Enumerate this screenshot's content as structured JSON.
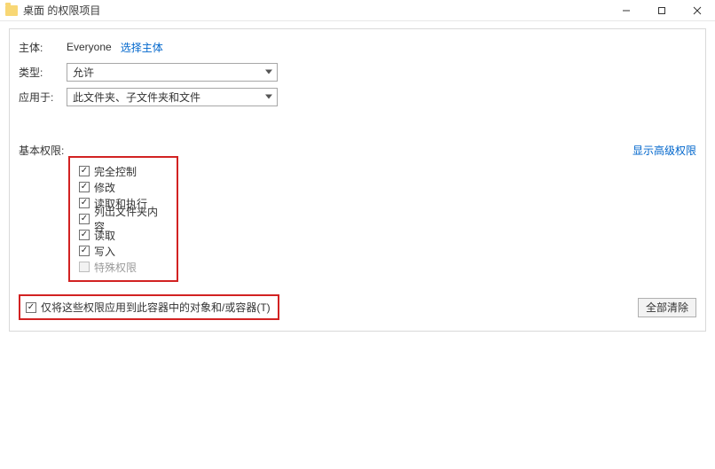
{
  "window": {
    "title": "桌面 的权限项目"
  },
  "principal": {
    "label": "主体:",
    "value": "Everyone",
    "select_link": "选择主体"
  },
  "type": {
    "label": "类型:",
    "value": "允许"
  },
  "applies_to": {
    "label": "应用于:",
    "value": "此文件夹、子文件夹和文件"
  },
  "permissions": {
    "title": "基本权限:",
    "show_advanced": "显示高级权限",
    "items": [
      {
        "label": "完全控制",
        "checked": true,
        "disabled": false
      },
      {
        "label": "修改",
        "checked": true,
        "disabled": false
      },
      {
        "label": "读取和执行",
        "checked": true,
        "disabled": false
      },
      {
        "label": "列出文件夹内容",
        "checked": true,
        "disabled": false
      },
      {
        "label": "读取",
        "checked": true,
        "disabled": false
      },
      {
        "label": "写入",
        "checked": true,
        "disabled": false
      },
      {
        "label": "特殊权限",
        "checked": false,
        "disabled": true
      }
    ]
  },
  "apply_only": {
    "label": "仅将这些权限应用到此容器中的对象和/或容器(T)",
    "checked": true
  },
  "buttons": {
    "clear_all": "全部清除"
  }
}
